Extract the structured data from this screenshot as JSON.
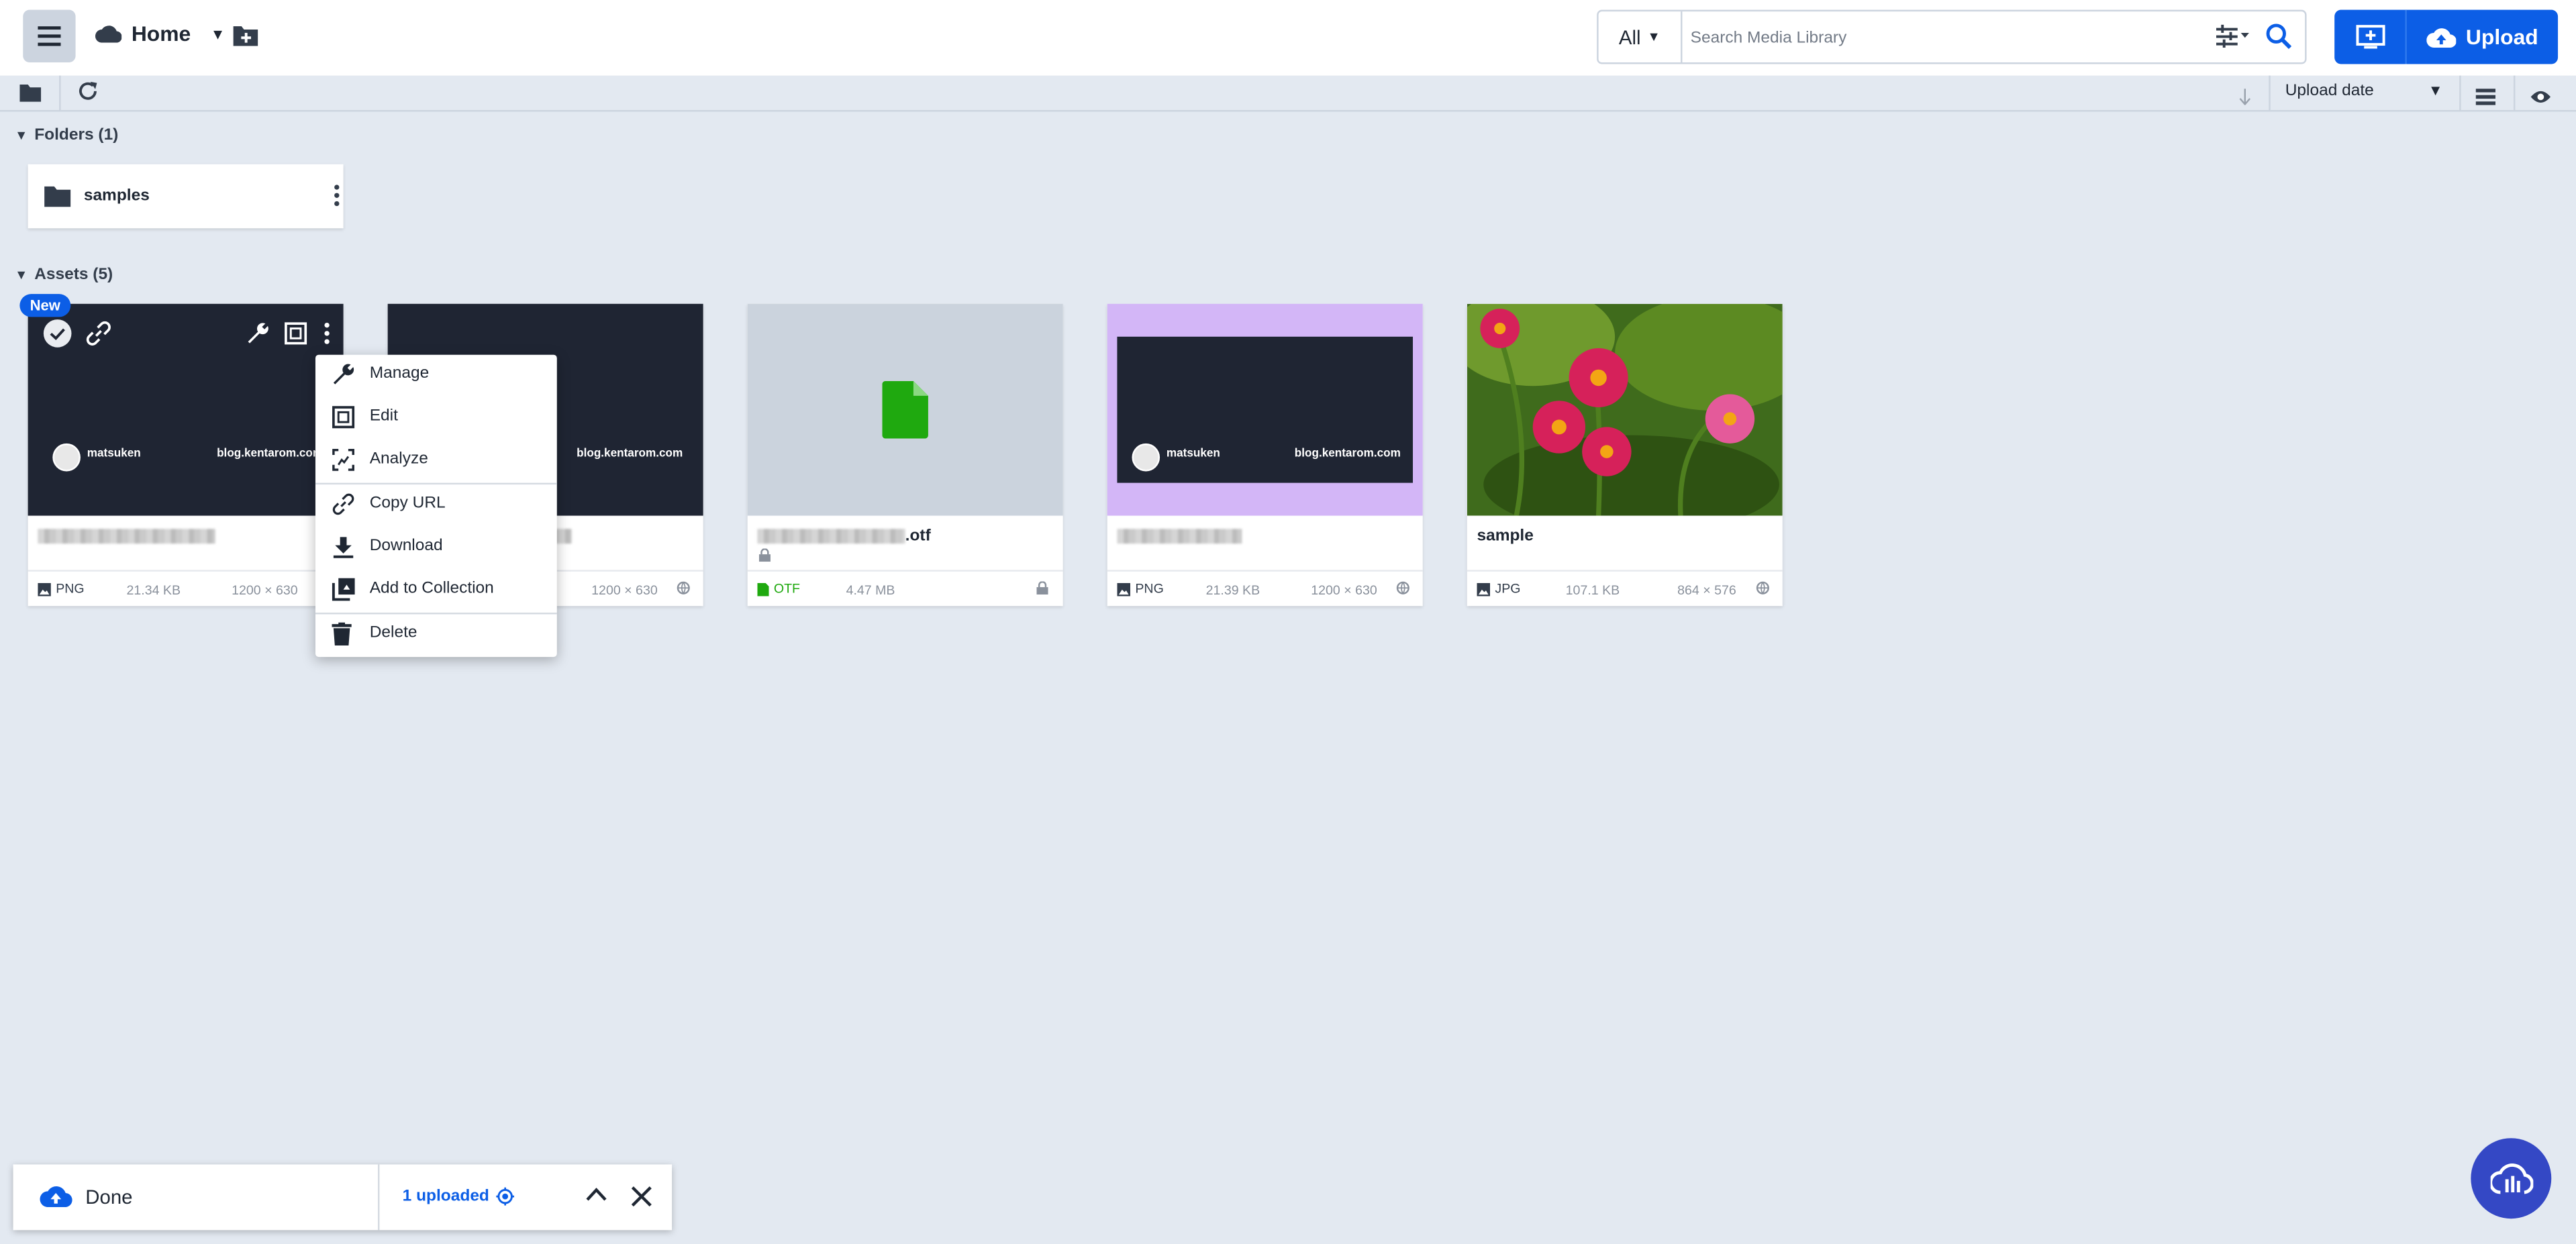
{
  "header": {
    "location": "Home",
    "search": {
      "scope": "All",
      "placeholder": "Search Media Library"
    },
    "upload_label": "Upload"
  },
  "toolbar": {
    "sort_label": "Upload date"
  },
  "folders": {
    "header": "Folders (1)",
    "items": [
      {
        "name": "samples"
      }
    ]
  },
  "assets": {
    "header": "Assets (5)",
    "new_badge": "New",
    "items": [
      {
        "name": "",
        "format": "PNG",
        "size": "21.34 KB",
        "dims": "1200 × 630",
        "banner_user": "matsuken",
        "banner_site": "blog.kentarom.com"
      },
      {
        "name": "",
        "format": "",
        "size": "",
        "dims": "1200 × 630",
        "banner_site": "blog.kentarom.com"
      },
      {
        "name": ".otf",
        "format": "OTF",
        "size": "4.47 MB",
        "dims": ""
      },
      {
        "name": "",
        "format": "PNG",
        "size": "21.39 KB",
        "dims": "1200 × 630",
        "banner_user": "matsuken",
        "banner_site": "blog.kentarom.com"
      },
      {
        "name": "sample",
        "format": "JPG",
        "size": "107.1 KB",
        "dims": "864 × 576"
      }
    ]
  },
  "context_menu": {
    "items": [
      {
        "label": "Manage",
        "icon": "wrench-icon"
      },
      {
        "label": "Edit",
        "icon": "crop-icon"
      },
      {
        "label": "Analyze",
        "icon": "analyze-icon"
      },
      {
        "label": "Copy URL",
        "icon": "link-icon"
      },
      {
        "label": "Download",
        "icon": "download-icon"
      },
      {
        "label": "Add to Collection",
        "icon": "collection-icon"
      },
      {
        "label": "Delete",
        "icon": "trash-icon"
      }
    ]
  },
  "upload_panel": {
    "status": "Done",
    "count": "1 uploaded"
  },
  "colors": {
    "accent": "#0c5ee6",
    "fab": "#3448c5",
    "otf_green": "#1fa90f",
    "purple_bg": "#d3b6f7"
  }
}
